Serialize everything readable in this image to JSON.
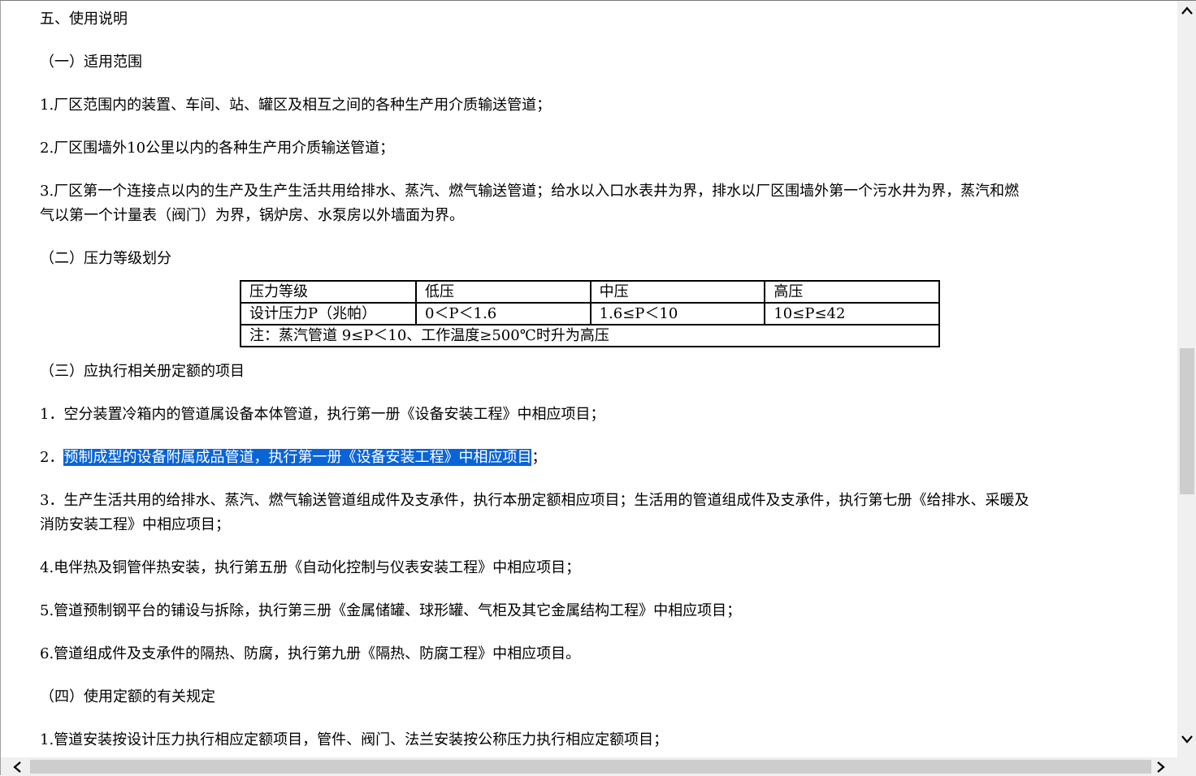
{
  "document": {
    "section_title": "五、使用说明",
    "sub1_title": "（一）适用范围",
    "sub1_items": [
      "1.厂区范围内的装置、车间、站、罐区及相互之间的各种生产用介质输送管道；",
      "2.厂区围墙外10公里以内的各种生产用介质输送管道；",
      "3.厂区第一个连接点以内的生产及生产生活共用给排水、蒸汽、燃气输送管道；给水以入口水表井为界，排水以厂区围墙外第一个污水井为界，蒸汽和燃",
      "气以第一个计量表（阀门）为界，锅炉房、水泵房以外墙面为界。"
    ],
    "sub2_title": "（二）压力等级划分",
    "pressure_table": {
      "headers": [
        "压力等级",
        "低压",
        "中压",
        "高压"
      ],
      "row": [
        "设计压力P（兆帕）",
        "0＜P＜1.6",
        "1.6≤P＜10",
        "10≤P≤42"
      ],
      "note": "注：蒸汽管道 9≤P＜10、工作温度≥500℃时升为高压"
    },
    "sub3_title": "（三）应执行相关册定额的项目",
    "sub3_items": {
      "item1": "1．空分装置冷箱内的管道属设备本体管道，执行第一册《设备安装工程》中相应项目；",
      "item2_prefix": "2．",
      "item2_selected": "预制成型的设备附属成品管道，执行第一册《设备安装工程》中相应项目",
      "item2_suffix": "；",
      "item3_line1": "3．生产生活共用的给排水、蒸汽、燃气输送管道组成件及支承件，执行本册定额相应项目；生活用的管道组成件及支承件，执行第七册《给排水、采暖及",
      "item3_line2": "消防安装工程》中相应项目；",
      "item4": "4.电伴热及铜管伴热安装，执行第五册《自动化控制与仪表安装工程》中相应项目；",
      "item5": "5.管道预制钢平台的铺设与拆除，执行第三册《金属储罐、球形罐、气柜及其它金属结构工程》中相应项目；",
      "item6": "6.管道组成件及支承件的隔热、防腐，执行第九册《隔热、防腐工程》中相应项目。"
    },
    "sub4_title": "（四）使用定额的有关规定",
    "sub4_items": [
      "1.管道安装按设计压力执行相应定额项目，管件、阀门、法兰安装按公称压力执行相应定额项目；"
    ]
  },
  "colors": {
    "selection": "#0a64d6",
    "scrollbar_track": "#f0f0f0",
    "scrollbar_thumb": "#cdcdcd"
  }
}
